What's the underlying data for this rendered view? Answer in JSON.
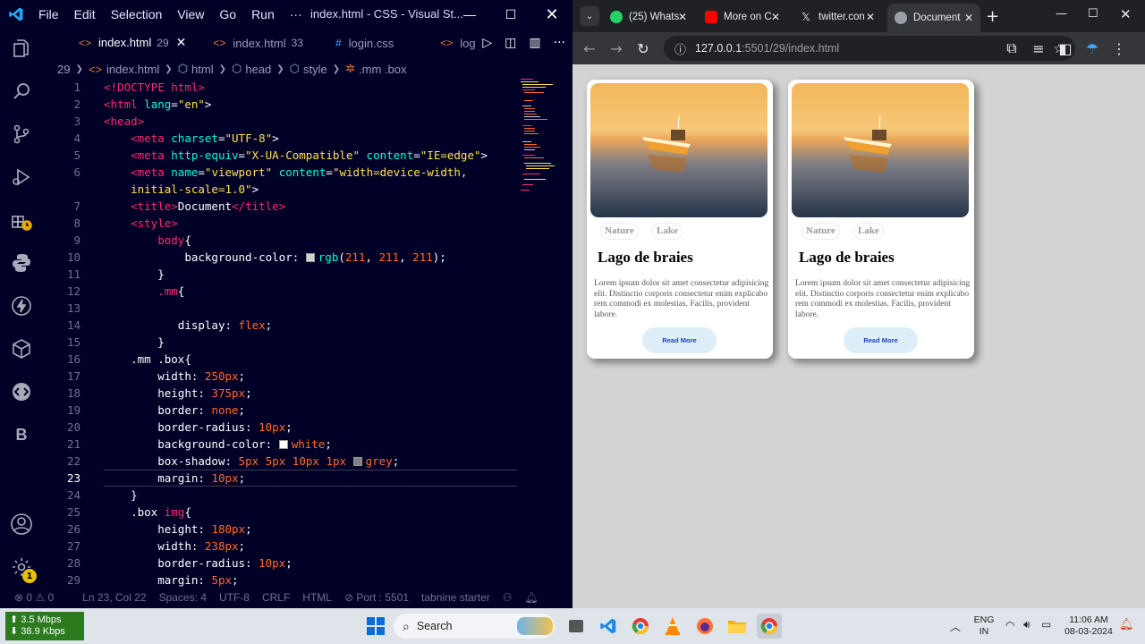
{
  "vscode": {
    "menu": [
      "File",
      "Edit",
      "Selection",
      "View",
      "Go",
      "Run",
      "···"
    ],
    "window_title": "index.html - CSS - Visual St...",
    "tabs": [
      {
        "label": "index.html",
        "count": "29",
        "active": true
      },
      {
        "label": "index.html",
        "count": "33",
        "active": false
      },
      {
        "label": "login.css",
        "count": "",
        "active": false
      },
      {
        "label": "log",
        "count": "",
        "active": false
      }
    ],
    "breadcrumb": [
      "29",
      "index.html",
      "html",
      "head",
      "style",
      ".mm .box"
    ],
    "lines": [
      {
        "n": "1"
      },
      {
        "n": "2"
      },
      {
        "n": "3"
      },
      {
        "n": "4"
      },
      {
        "n": "5"
      },
      {
        "n": "6"
      },
      {
        "n": ""
      },
      {
        "n": "7"
      },
      {
        "n": "8"
      },
      {
        "n": "9"
      },
      {
        "n": "10"
      },
      {
        "n": "11"
      },
      {
        "n": "12"
      },
      {
        "n": "13"
      },
      {
        "n": "14"
      },
      {
        "n": "15"
      },
      {
        "n": "16"
      },
      {
        "n": "17"
      },
      {
        "n": "18"
      },
      {
        "n": "19"
      },
      {
        "n": "20"
      },
      {
        "n": "21"
      },
      {
        "n": "22"
      },
      {
        "n": "23"
      },
      {
        "n": "24"
      },
      {
        "n": "25"
      },
      {
        "n": "26"
      },
      {
        "n": "27"
      },
      {
        "n": "28"
      },
      {
        "n": "29"
      }
    ],
    "code": {
      "doctype": "<!DOCTYPE html>",
      "l2_tag": "<html",
      "l2_attr": "lang",
      "l2_val": "\"en\"",
      "l3": "<head>",
      "l4_tag": "<meta",
      "l4_attr": "charset",
      "l4_val": "\"UTF-8\"",
      "l5_tag": "<meta",
      "l5_attr1": "http-equiv",
      "l5_val1": "\"X-UA-Compatible\"",
      "l5_attr2": "content",
      "l5_val2": "\"IE=edge\"",
      "l6_tag": "<meta",
      "l6_attr1": "name",
      "l6_val1": "\"viewport\"",
      "l6_attr2": "content",
      "l6_val2a": "\"width=device-width,",
      "l6_val2b": "initial-scale=1.0\"",
      "l7_open": "<title>",
      "l7_text": "Document",
      "l7_close": "</title>",
      "l8": "<style>",
      "l9_sel": "body",
      "l10_prop": "background-color:",
      "l10_fn": "rgb",
      "l10_a": "211",
      "l10_b": "211",
      "l10_c": "211",
      "l11": "}",
      "l12_sel": ".mm",
      "l14_prop": "display:",
      "l14_val": "flex",
      "l15": "}",
      "l16_sel": ".mm .box",
      "l17_prop": "width:",
      "l17_num": "250",
      "l17_unit": "px",
      "l18_prop": "height:",
      "l18_num": "375",
      "l18_unit": "px",
      "l19_prop": "border:",
      "l19_val": "none",
      "l20_prop": "border-radius:",
      "l20_num": "10",
      "l20_unit": "px",
      "l21_prop": "background-color:",
      "l21_val": "white",
      "l22_prop": "box-shadow:",
      "l22_a": "5",
      "l22_b": "5",
      "l22_c": "10",
      "l22_d": "1",
      "l22_unit": "px",
      "l22_val": "grey",
      "l23_prop": "margin:",
      "l23_num": "10",
      "l23_unit": "px",
      "l24": "}",
      "l25_sel": ".box",
      "l25_tag": "img",
      "l26_prop": "height:",
      "l26_num": "180",
      "l26_unit": "px",
      "l27_prop": "width:",
      "l27_num": "238",
      "l27_unit": "px",
      "l28_prop": "border-radius:",
      "l28_num": "10",
      "l28_unit": "px",
      "l29_prop": "margin:",
      "l29_num": "5",
      "l29_unit": "px"
    },
    "status": {
      "errors": "⊗ 0 ⚠ 0",
      "position": "Ln 23, Col 22",
      "spaces": "Spaces: 4",
      "encoding": "UTF-8",
      "eol": "CRLF",
      "language": "HTML",
      "port": "⊘ Port : 5501",
      "tabnine": "tabnine starter"
    },
    "settings_badge": "1"
  },
  "chrome": {
    "tabs": [
      {
        "label": "(25) Whats",
        "color": "#25d366"
      },
      {
        "label": "More on C",
        "color": "#ff0000"
      },
      {
        "label": "twitter.con",
        "color": "#000000"
      },
      {
        "label": "Document",
        "color": "#9aa0a6"
      }
    ],
    "url_host": "127.0.0.1",
    "url_path": ":5501/29/index.html",
    "cards": [
      {
        "tag1": "Nature",
        "tag2": "Lake",
        "title": "Lago de braies",
        "text": "Lorem ipsum dolor sit amet consectetur adipisicing elit. Distinctio corporis consectetur enim explicabo rem commodi ex molestias. Facilis, provident labore.",
        "button": "Read More"
      },
      {
        "tag1": "Nature",
        "tag2": "Lake",
        "title": "Lago de braies",
        "text": "Lorem ipsum dolor sit amet consectetur adipisicing elit. Distinctio corporis consectetur enim explicabo rem commodi ex molestias. Facilis, provident labore.",
        "button": "Read More"
      }
    ]
  },
  "taskbar": {
    "upload": "⬆ 3.5 Mbps",
    "download": "⬇ 38.9 Kbps",
    "search": "Search",
    "lang1": "ENG",
    "lang2": "IN",
    "time": "11:06 AM",
    "date": "08-03-2024"
  },
  "colors": {
    "editor_bg": "#010127",
    "page_bg": "#d3d3d3",
    "accent": "#ff2a6d"
  }
}
